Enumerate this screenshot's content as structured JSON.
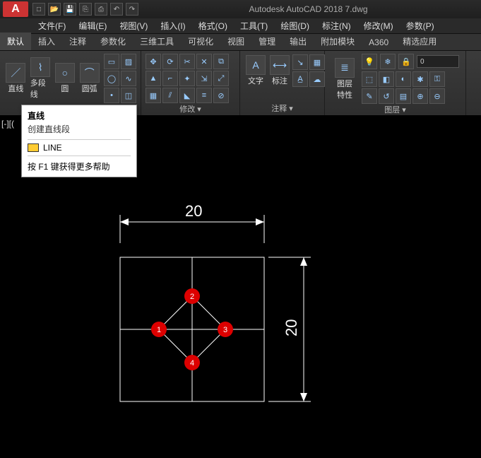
{
  "title": "Autodesk AutoCAD 2018   7.dwg",
  "logo": "A",
  "menus": [
    "文件(F)",
    "编辑(E)",
    "视图(V)",
    "插入(I)",
    "格式(O)",
    "工具(T)",
    "绘图(D)",
    "标注(N)",
    "修改(M)",
    "参数(P)"
  ],
  "ribbon_tabs": [
    "默认",
    "插入",
    "注释",
    "参数化",
    "三维工具",
    "可视化",
    "视图",
    "管理",
    "输出",
    "附加模块",
    "A360",
    "精选应用"
  ],
  "active_tab": 0,
  "draw_panel": {
    "line": "直线",
    "polyline": "多段线",
    "circle": "圆",
    "arc": "圆弧"
  },
  "modify_panel_title": "修改 ▾",
  "annot_panel": {
    "text": "文字",
    "dim": "标注",
    "title": "注释 ▾"
  },
  "layers_panel": {
    "props": "图层\n特性",
    "combo_value": "0",
    "title": "图层 ▾"
  },
  "tooltip": {
    "title": "直线",
    "subtitle": "创建直线段",
    "cmd": "LINE",
    "help": "按 F1 键获得更多帮助"
  },
  "viewport_label": "[-][(",
  "drawing": {
    "dim_top": "20",
    "dim_right": "20",
    "markers": [
      "1",
      "2",
      "3",
      "4"
    ]
  }
}
